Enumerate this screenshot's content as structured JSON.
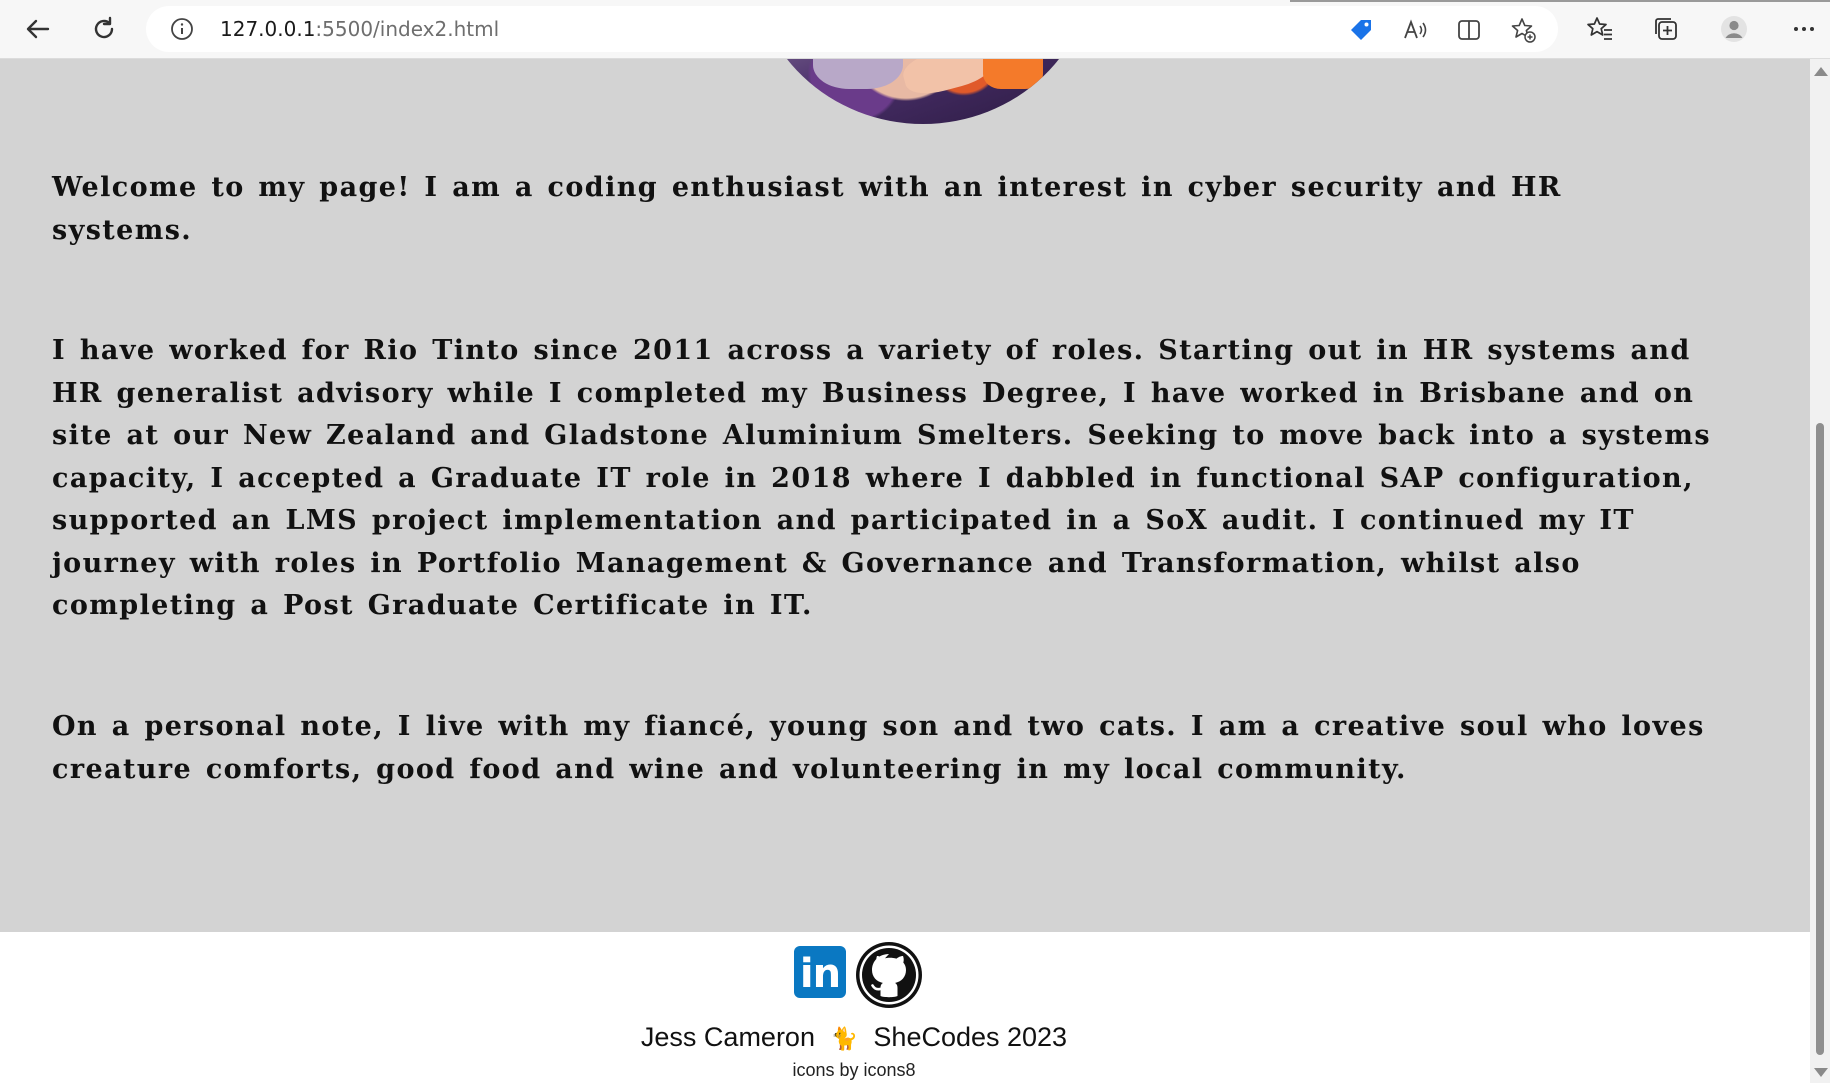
{
  "browser": {
    "url_host": "127.0.0.1",
    "url_path": ":5500/index2.html"
  },
  "page": {
    "paragraphs": [
      "Welcome to my page! I am a coding enthusiast with an interest in cyber security and HR systems.",
      "I have worked for Rio Tinto since 2011 across a variety of roles. Starting out in HR systems and HR generalist advisory while I completed my Business Degree, I have worked in Brisbane and on site at our New Zealand and Gladstone Aluminium Smelters. Seeking to move back into a systems capacity, I accepted a Graduate IT role in 2018 where I dabbled in functional SAP configuration, supported an LMS project implementation and participated in a SoX audit. I continued my IT journey with roles in Portfolio Management & Governance and Transformation, whilst also completing a Post Graduate Certificate in IT.",
      "On a personal note, I live with my fiancé, young son and two cats. I am a creative soul who loves creature comforts, good food and wine and volunteering in my local community."
    ]
  },
  "footer": {
    "linkedin_label": "in",
    "credit_name": "Jess Cameron",
    "credit_emoji": "🐈",
    "credit_org": "SheCodes 2023",
    "icons_credit": "icons by icons8"
  },
  "icons": {
    "back": "back-arrow-icon",
    "refresh": "refresh-icon",
    "info": "info-icon",
    "coupon": "tag-icon",
    "read_aloud": "read-aloud-icon",
    "split": "split-screen-icon",
    "add_favorite": "star-plus-icon",
    "favorites": "favorites-icon",
    "collections": "collections-icon",
    "profile": "profile-icon",
    "menu": "more-icon"
  },
  "colors": {
    "content_bg": "#d3d3d3",
    "linkedin": "#0a78c2",
    "tag_blue": "#1a73e8"
  }
}
